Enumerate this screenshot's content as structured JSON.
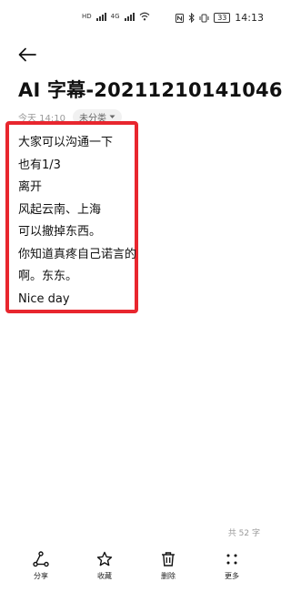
{
  "status_bar": {
    "network_label_1": "HD",
    "network_label_2": "4G",
    "battery": "33",
    "time": "14:13"
  },
  "header": {
    "back_icon": "arrow-left-icon",
    "title": "AI 字幕-20211210141046"
  },
  "meta": {
    "time": "今天 14:10",
    "category": "未分类"
  },
  "content": {
    "lines": [
      "大家可以沟通一下",
      "也有1/3",
      "离开",
      "风起云南、上海",
      "可以撤掉东西。",
      "你知道真疼自己诺言的",
      "啊。东东。",
      "Nice day"
    ],
    "highlight_color": "#e8262e"
  },
  "footer": {
    "word_count": "共 52 字"
  },
  "toolbar": {
    "share_label": "分享",
    "favorite_label": "收藏",
    "delete_label": "删除",
    "more_label": "更多"
  }
}
